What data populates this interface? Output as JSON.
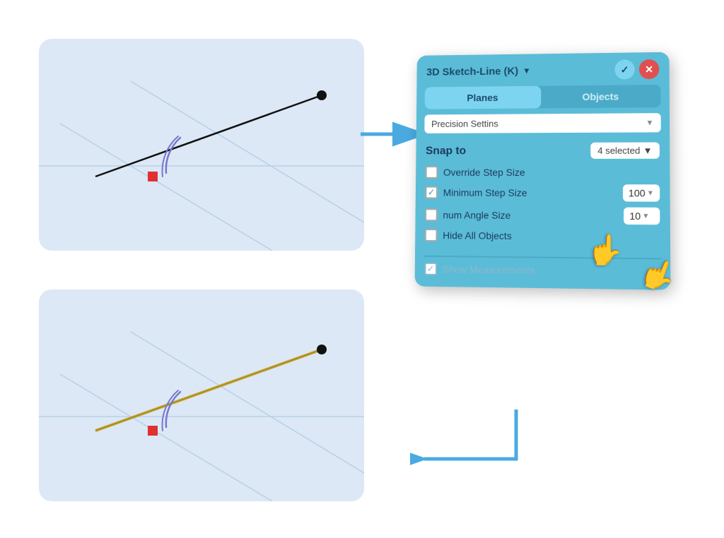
{
  "panel": {
    "title": "3D Sketch-Line (K)",
    "tabs": [
      {
        "label": "Planes",
        "active": true
      },
      {
        "label": "Objects",
        "active": false
      }
    ],
    "precision_dropdown": "Precision Settins",
    "snap_label": "Snap to",
    "snap_badge": "4 selected",
    "options": [
      {
        "id": "override-step",
        "checked": false,
        "label": "Override Step Size",
        "has_input": false
      },
      {
        "id": "min-step",
        "checked": true,
        "label": "Minimum Step Size",
        "has_input": true,
        "input_value": "100"
      },
      {
        "id": "min-angle",
        "checked": false,
        "label": "num Angle Size",
        "has_input": true,
        "input_value": "10"
      },
      {
        "id": "hide-objects",
        "checked": false,
        "label": "Hide All Objects",
        "has_input": false
      },
      {
        "id": "show-measurements",
        "checked": true,
        "label": "Show Measurements",
        "muted": true,
        "has_input": false
      }
    ]
  },
  "arrows": {
    "right_arrow": "→",
    "left_arrow": "←"
  }
}
